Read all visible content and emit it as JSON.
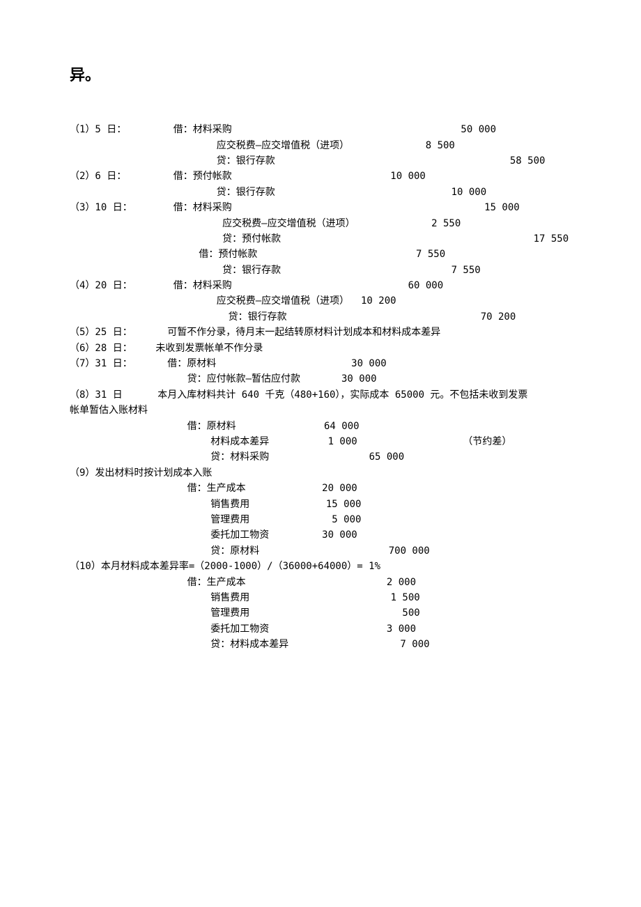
{
  "header": "异。",
  "lines": [
    "（1）5 日：        借：材料采购                                       50 000",
    "                         应交税费—应交增值税（进项）             8 500",
    "                         贷：银行存款                                        58 500",
    "（2）6 日：        借：预付帐款                           10 000",
    "                         贷：银行存款                              10 000",
    "（3）10 日：       借：材料采购                                           15 000",
    "                          应交税费—应交增值税（进项）             2 550",
    "                          贷：预付帐款                                           17 550",
    "                      借：预付帐款                           7 550",
    "                          贷：银行存款                             7 550",
    "（4）20 日：       借：材料采购                              60 000",
    "                         应交税费—应交增值税（进项）  10 200",
    "                           贷：银行存款                                 70 200",
    "（5）25 日：      可暂不作分录，待月末一起结转原材料计划成本和材料成本差异",
    "（6）28 日：    未收到发票帐单不作分录",
    "（7）31 日：      借：原材料                       30 000",
    "                    贷：应付帐款—暂估应付款       30 000",
    "（8）31 日      本月入库材料共计 640 千克（480+160），实际成本 65000 元。不包括未收到发票",
    "帐单暂估入账材料",
    "                    借：原材料               64 000",
    "                        材料成本差异          1 000                  （节约差）",
    "                        贷：材料采购                 65 000",
    "（9）发出材料时按计划成本入账",
    "                    借：生产成本             20 000",
    "                        销售费用             15 000",
    "                        管理费用              5 000",
    "                        委托加工物资         30 000",
    "                        贷：原材料                      700 000",
    "（10）本月材料成本差异率=（2000-1000）/（36000+64000）= 1%",
    "                    借：生产成本                        2 000",
    "                        销售费用                        1 500",
    "                        管理费用                          500",
    "                        委托加工物资                    3 000",
    "                        贷：材料成本差异                   7 000"
  ]
}
